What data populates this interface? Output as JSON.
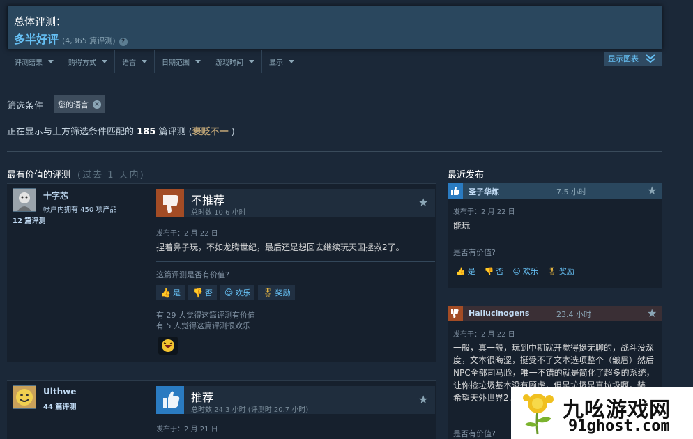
{
  "summary": {
    "title": "总体评测：",
    "score": "多半好评",
    "count": "(4,365 篇评测)",
    "help": "?"
  },
  "filters": [
    "评测结果",
    "购得方式",
    "语言",
    "日期范围",
    "游戏时间",
    "显示"
  ],
  "show_graph": "显示图表",
  "filter_label": "筛选条件",
  "lang_chip": "您的语言",
  "lang_chip_x": "×",
  "showing": {
    "prefix": "正在显示与上方筛选条件匹配的",
    "count": "185",
    "suffix": "篇评测 (",
    "mixed": "褒贬不一",
    "close": " )"
  },
  "helpful_section": {
    "title": "最有价值的评测",
    "subtitle": "(过去 1 天内)"
  },
  "recent_section": {
    "title": "最近发布"
  },
  "reviews": [
    {
      "author": "十字芯",
      "products": "帐户内拥有 450 项产品",
      "reviews": "12 篇评测",
      "verdict": "不推荐",
      "hours": "总时数 10.6 小时",
      "posted": "发布于：2 月 22 日",
      "text": "捏着鼻子玩，不如龙腾世纪，最后还是想回去继续玩天国拯救2了。",
      "helpful_q": "这篇评测是否有价值?",
      "votes": {
        "yes": "是",
        "no": "否",
        "funny": "欢乐",
        "award": "奖励"
      },
      "found1": "有 29 人觉得这篇评测有价值",
      "found2": "有 5 人觉得这篇评测很欢乐"
    },
    {
      "author": "Ulthwe",
      "reviews": "44 篇评测",
      "verdict": "推荐",
      "hours": "总时数 24.3 小时  (评测时 20.7 小时)",
      "posted": "发布于：2 月 21 日"
    }
  ],
  "recent": [
    {
      "author": "圣子华炼",
      "hours": "7.5 小时",
      "posted": "发布于：2 月 22 日",
      "text": "能玩",
      "helpful_q": "是否有价值?",
      "votes": {
        "yes": "是",
        "no": "否",
        "funny": "欢乐",
        "award": "奖励"
      }
    },
    {
      "author": "Hallucinogens",
      "hours": "23.4 小时",
      "posted": "发布于：2 月 22 日",
      "text": "一般，真一般，玩到中期就开觉得挺无聊的，战斗没深度，文本很晦涩，挺受不了文本选项整个（皱眉）然后NPC全部司马脸，唯一不错的就是简化了超多的系统，让你捡垃圾基本没有顾虑，但是垃圾是真垃圾啊，装…希望天外世界2…",
      "helpful_q": "是否有价值?"
    }
  ],
  "watermark": {
    "title": "九吆游戏网",
    "url": "91ghost.com"
  }
}
